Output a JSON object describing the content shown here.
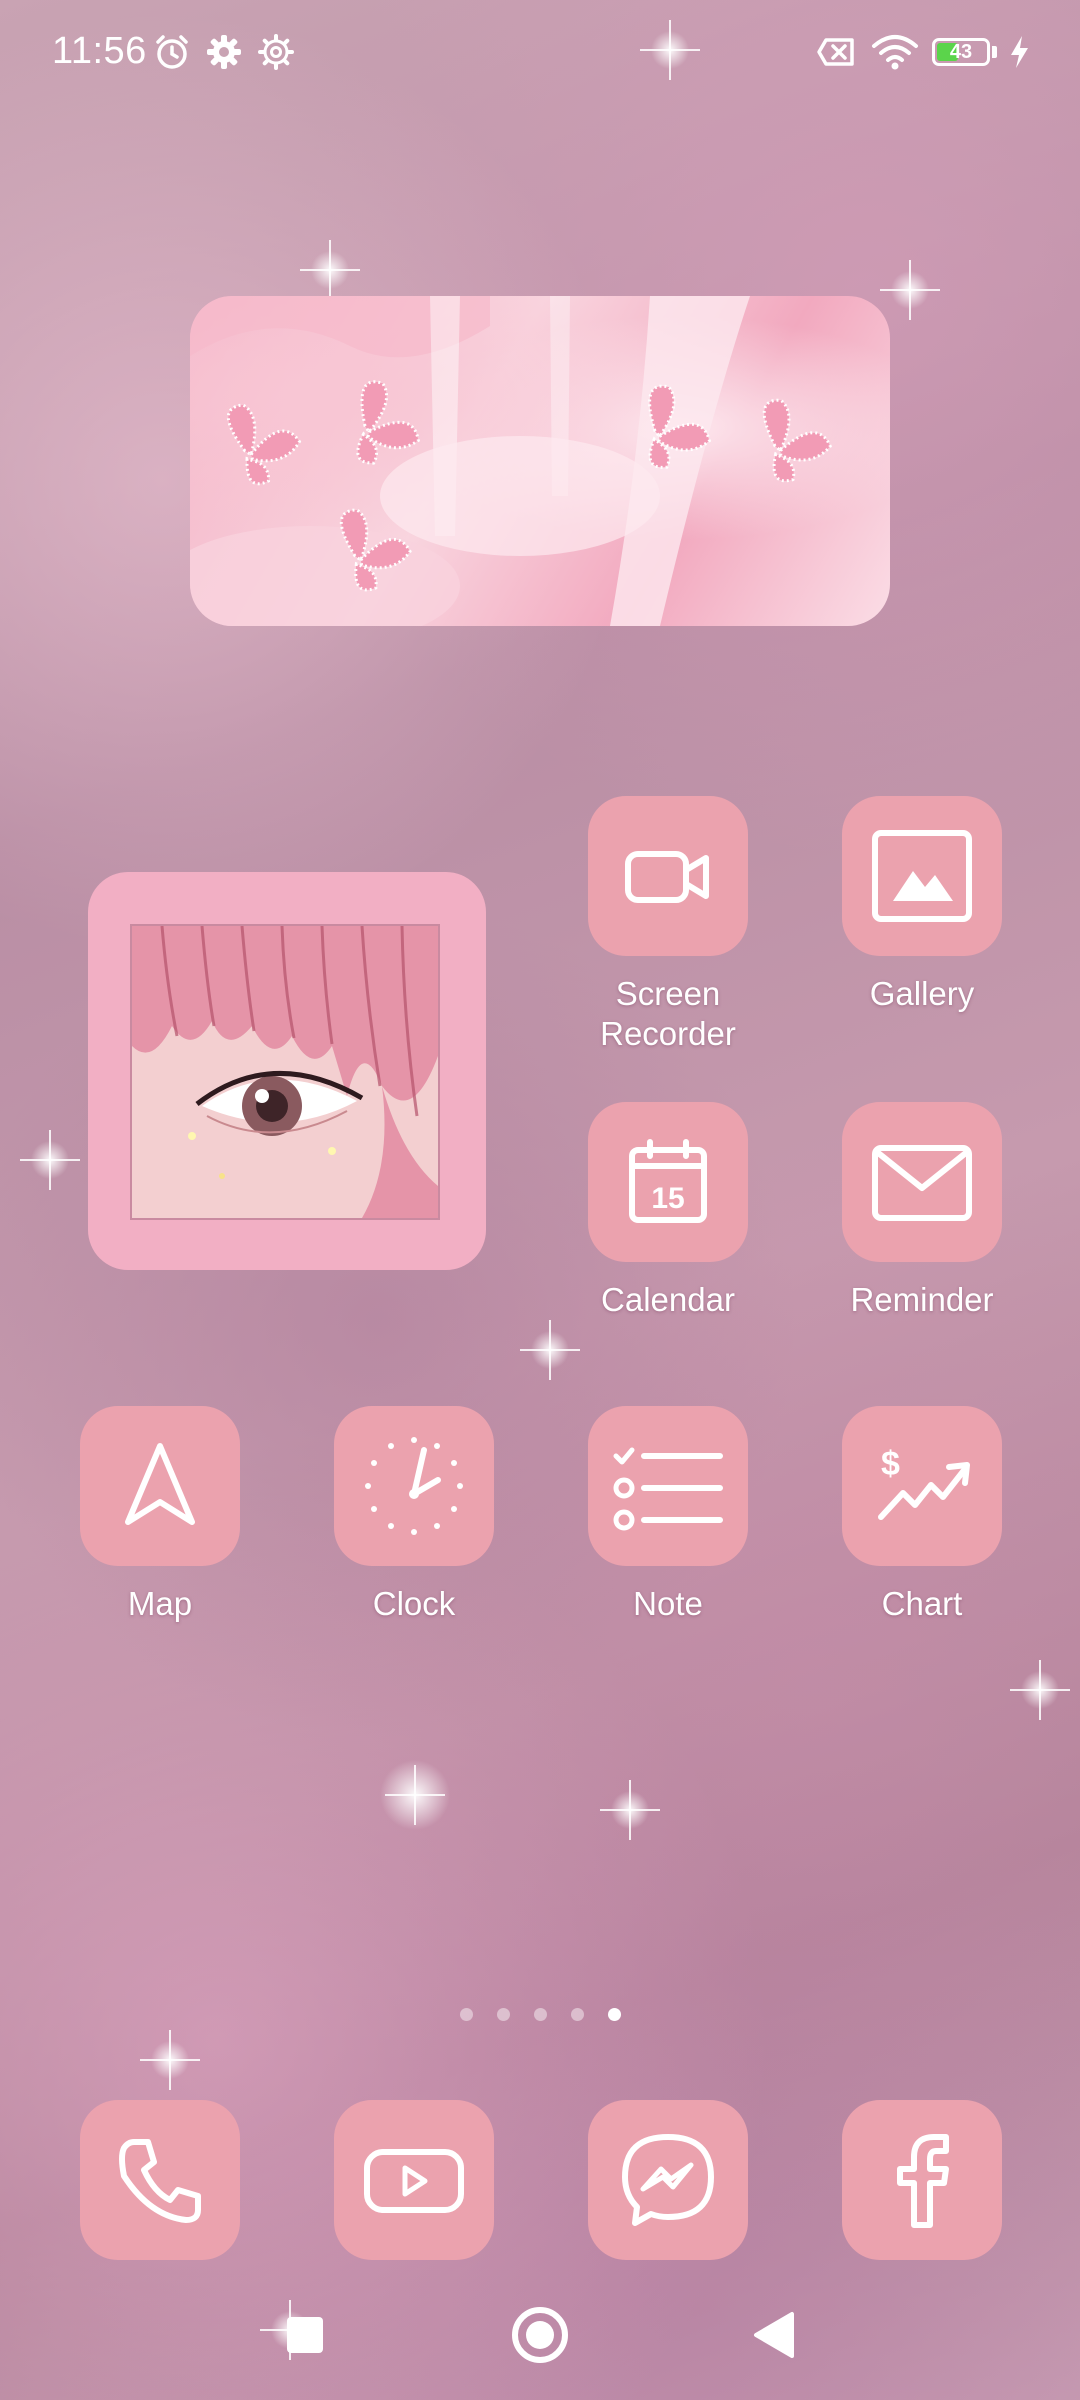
{
  "status_bar": {
    "time": "11:56",
    "icons": [
      "alarm-icon",
      "settings-gear-icon",
      "settings-cog-icon",
      "no-sim-icon",
      "wifi-icon",
      "battery-icon",
      "charging-bolt-icon"
    ],
    "battery_level": 43,
    "battery_label": "43"
  },
  "widgets": {
    "top": "butterfly-image-widget",
    "photo": "anime-eye-photo-widget"
  },
  "apps": [
    {
      "label": "Screen Recorder",
      "label_line1": "Screen",
      "label_line2": "Recorder",
      "icon": "video-camera-icon"
    },
    {
      "label": "Gallery",
      "icon": "image-icon"
    },
    {
      "label": "Calendar",
      "icon": "calendar-icon",
      "calendar_day": "15"
    },
    {
      "label": "Reminder",
      "icon": "envelope-icon"
    },
    {
      "label": "Map",
      "icon": "navigation-arrow-icon"
    },
    {
      "label": "Clock",
      "icon": "clock-icon"
    },
    {
      "label": "Note",
      "icon": "checklist-icon"
    },
    {
      "label": "Chart",
      "icon": "stock-chart-icon"
    }
  ],
  "page_indicator": {
    "total": 5,
    "active_index": 4
  },
  "dock": [
    {
      "icon": "phone-icon"
    },
    {
      "icon": "youtube-icon"
    },
    {
      "icon": "messenger-icon"
    },
    {
      "icon": "facebook-icon"
    }
  ],
  "nav_bar": [
    "recents-square-icon",
    "home-circle-icon",
    "back-triangle-icon"
  ],
  "colors": {
    "tile": "#eba2ae",
    "photo_frame": "#f2afc4",
    "battery": "#5bd44b"
  }
}
